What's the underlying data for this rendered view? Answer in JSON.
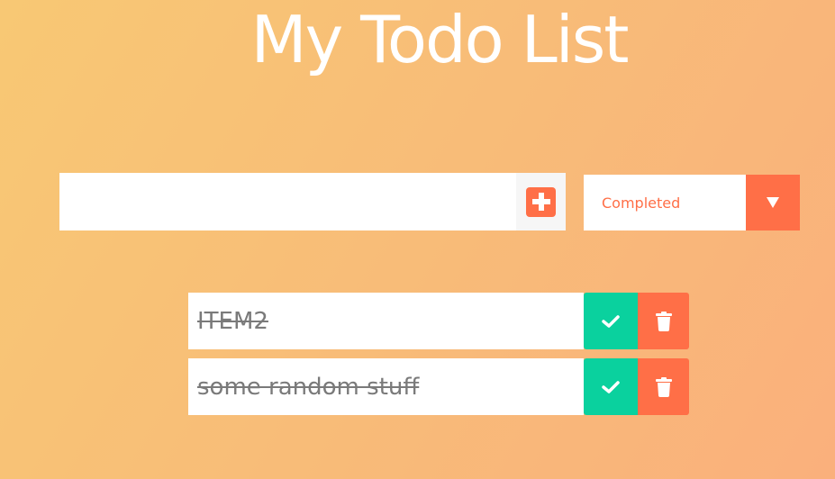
{
  "header": {
    "title": "My Todo List"
  },
  "form": {
    "input_value": "",
    "add_icon": "plus-square-icon",
    "filter": {
      "selected": "Completed",
      "arrow_icon": "caret-down-icon"
    }
  },
  "todos": [
    {
      "text": "ITEM2",
      "completed": true
    },
    {
      "text": "some random stuff",
      "completed": true
    }
  ],
  "colors": {
    "accent": "#ff6f47",
    "complete": "#0ad19e",
    "gradient_start": "#f8c874",
    "gradient_end": "#fab07c"
  }
}
